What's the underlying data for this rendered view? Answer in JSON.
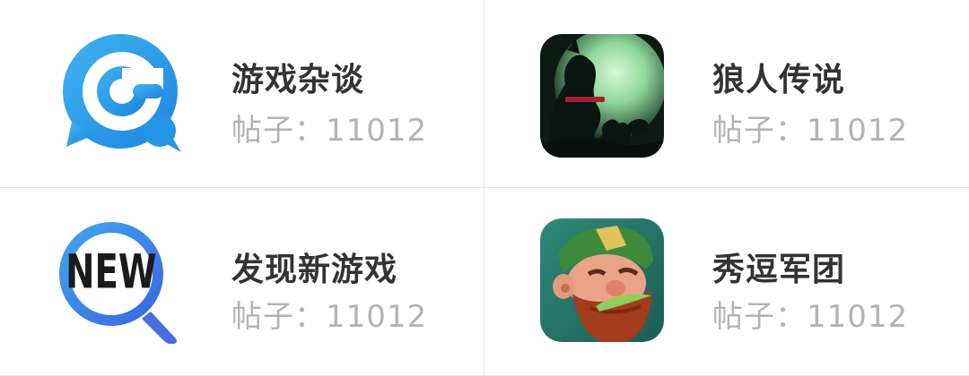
{
  "forums": [
    {
      "title": "游戏杂谈",
      "posts_label": "帖子：",
      "posts_count": "11012",
      "icon": "chat-bubble-g-icon"
    },
    {
      "title": "狼人传说",
      "posts_label": "帖子：",
      "posts_count": "11012",
      "icon": "werewolf-game-icon"
    },
    {
      "title": "发现新游戏",
      "posts_label": "帖子：",
      "posts_count": "11012",
      "icon": "new-magnifier-icon"
    },
    {
      "title": "秀逗军团",
      "posts_label": "帖子：",
      "posts_count": "11012",
      "icon": "bearded-warrior-game-icon"
    }
  ],
  "icon_texts": {
    "new": "NEW"
  },
  "colors": {
    "title": "#333333",
    "count": "#b3b3b3",
    "divider": "#e6e6e6",
    "chat_blue": "#2a9de8"
  }
}
